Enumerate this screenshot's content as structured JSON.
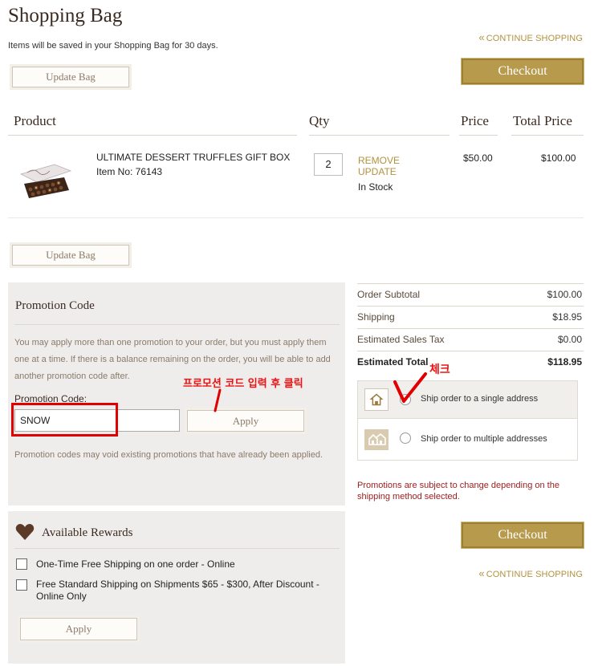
{
  "page": {
    "title": "Shopping Bag",
    "save_note": "Items will be saved in your Shopping Bag for 30 days.",
    "continue_shopping": "CONTINUE SHOPPING",
    "continue_chevron": "«",
    "checkout_label": "Checkout",
    "update_bag_label": "Update Bag"
  },
  "table": {
    "headers": {
      "product": "Product",
      "qty": "Qty",
      "price": "Price",
      "total_price": "Total Price"
    },
    "rows": [
      {
        "name": "ULTIMATE DESSERT TRUFFLES GIFT BOX",
        "item_no": "Item No: 76143",
        "qty": "2",
        "remove_label": "REMOVE",
        "update_label": "UPDATE",
        "stock": "In Stock",
        "price": "$50.00",
        "total": "$100.00"
      }
    ]
  },
  "promotion": {
    "title": "Promotion Code",
    "description": "You may apply more than one promotion to your order, but you must apply them one at a time. If there is a balance remaining on the order, you will be able to add another promotion code after.",
    "code_label": "Promotion Code:",
    "code_value": "SNOW",
    "apply_label": "Apply",
    "note": "Promotion codes may void existing promotions that have already been applied.",
    "annotation": "프로모션 코드 입력 후 클릭"
  },
  "rewards": {
    "title": "Available Rewards",
    "items": [
      {
        "label": "One-Time Free Shipping on one order - Online",
        "checked": false
      },
      {
        "label": "Free Standard Shipping on Shipments $65 - $300, After Discount - Online Only",
        "checked": false
      }
    ],
    "apply_label": "Apply"
  },
  "summary": {
    "subtotal_label": "Order Subtotal",
    "subtotal": "$100.00",
    "shipping_label": "Shipping",
    "shipping": "$18.95",
    "tax_label": "Estimated Sales Tax",
    "tax": "$0.00",
    "total_label": "Estimated Total",
    "total": "$118.95"
  },
  "shipping": {
    "single_label": "Ship order to a single address",
    "multi_label": "Ship order to multiple addresses",
    "annotation": "체크",
    "notice": "Promotions are subject to change depending on the shipping method selected."
  },
  "colors": {
    "accent_gold": "#b89a4c",
    "link_gold": "#b2923f",
    "notice_red": "#9c1d1d",
    "annotation_red": "#e00000"
  }
}
